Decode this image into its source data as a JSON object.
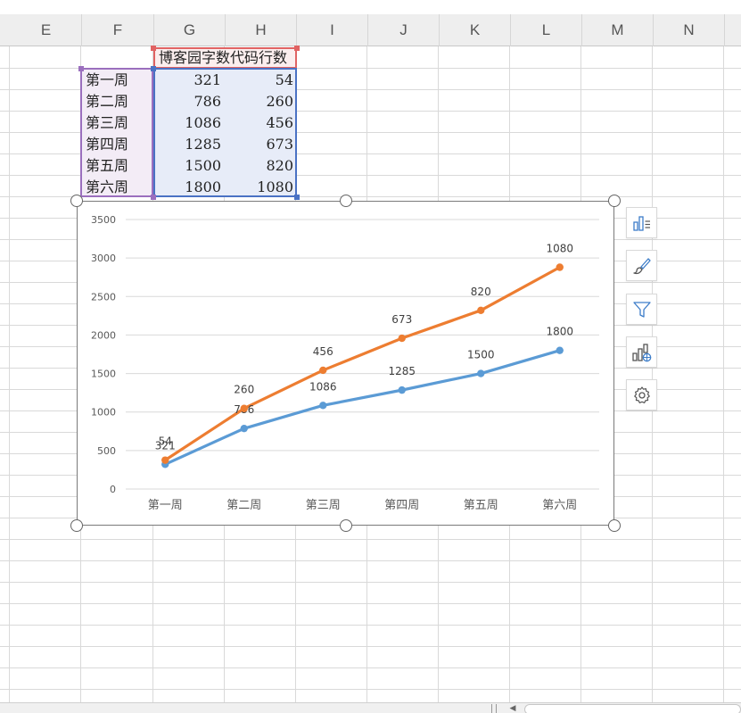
{
  "columns": [
    "E",
    "F",
    "G",
    "H",
    "I",
    "J",
    "K",
    "L",
    "M",
    "N"
  ],
  "table": {
    "header": "博客园字数代码行数",
    "rows": [
      {
        "week": "第一周",
        "chars": "321",
        "lines": "54"
      },
      {
        "week": "第二周",
        "chars": "786",
        "lines": "260"
      },
      {
        "week": "第三周",
        "chars": "1086",
        "lines": "456"
      },
      {
        "week": "第四周",
        "chars": "1285",
        "lines": "673"
      },
      {
        "week": "第五周",
        "chars": "1500",
        "lines": "820"
      },
      {
        "week": "第六周",
        "chars": "1800",
        "lines": "1080"
      }
    ]
  },
  "side_buttons": [
    "chart-elements-icon",
    "chart-style-icon",
    "chart-filter-icon",
    "chart-type-icon",
    "chart-settings-icon"
  ],
  "chart_data": {
    "type": "line",
    "categories": [
      "第一周",
      "第二周",
      "第三周",
      "第四周",
      "第五周",
      "第六周"
    ],
    "series": [
      {
        "values": [
          321,
          786,
          1086,
          1285,
          1500,
          1800
        ],
        "color": "#5b9bd5"
      },
      {
        "values": [
          375,
          1046,
          1542,
          1958,
          2320,
          2880
        ],
        "labels": [
          "54",
          "260",
          "456",
          "673",
          "820",
          "1080"
        ],
        "color": "#ed7d31"
      }
    ],
    "yticks": [
      "0",
      "500",
      "1000",
      "1500",
      "2000",
      "2500",
      "3000",
      "3500"
    ],
    "ylim": [
      0,
      3500
    ],
    "grid": true,
    "stacked": true,
    "title": "",
    "xlabel": "",
    "ylabel": ""
  }
}
